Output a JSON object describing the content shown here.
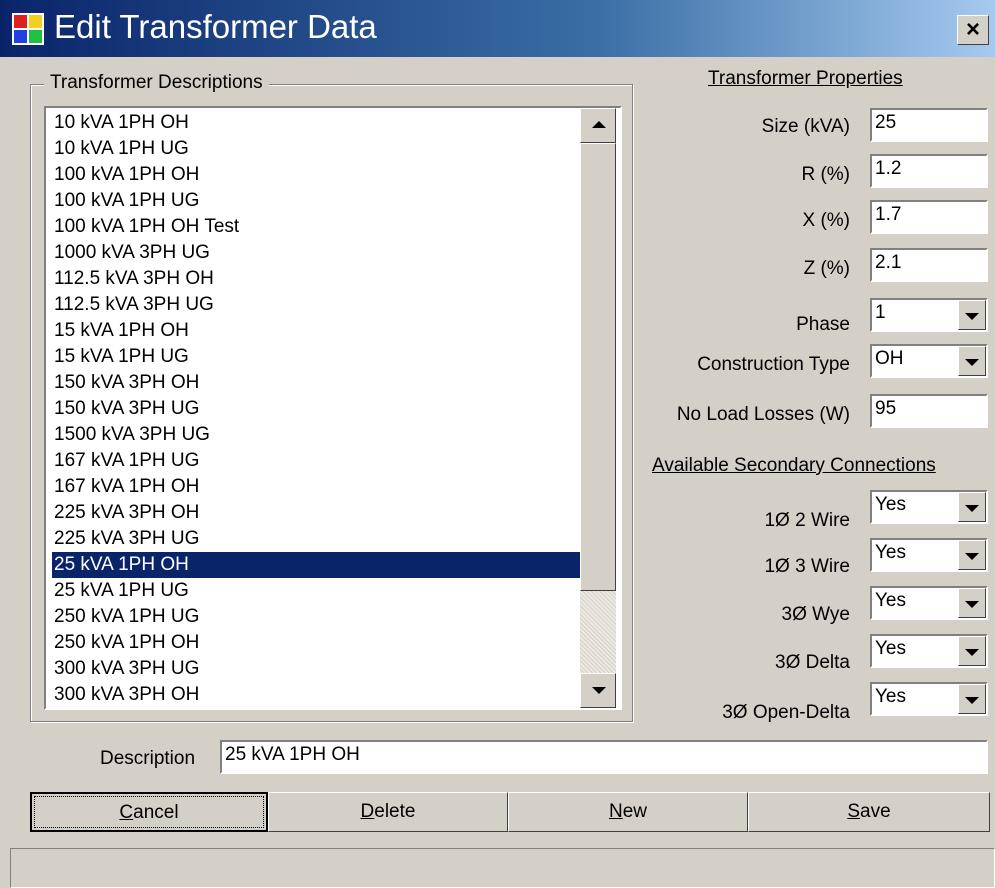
{
  "window": {
    "title": "Edit Transformer Data",
    "close_label": "×"
  },
  "descriptions": {
    "group_label": "Transformer Descriptions",
    "items": [
      "10 kVA 1PH OH",
      "10 kVA 1PH UG",
      "100 kVA 1PH OH",
      "100 kVA 1PH UG",
      "100 kVA 1PH OH Test",
      "1000 kVA 3PH UG",
      "112.5 kVA 3PH OH",
      "112.5 kVA 3PH UG",
      "15 kVA 1PH OH",
      "15 kVA 1PH UG",
      "150 kVA 3PH OH",
      "150 kVA 3PH UG",
      "1500 kVA 3PH UG",
      "167 kVA 1PH UG",
      "167 kVA 1PH OH",
      "225 kVA 3PH OH",
      "225 kVA 3PH UG",
      "25 kVA 1PH OH",
      "25 kVA 1PH UG",
      "250 kVA 1PH UG",
      "250 kVA 1PH OH",
      "300 kVA 3PH UG",
      "300 kVA 3PH OH"
    ],
    "selected": "25 kVA 1PH OH"
  },
  "properties": {
    "heading": "Transformer Properties",
    "size_label": "Size (kVA)",
    "size_value": "25",
    "r_label": "R (%)",
    "r_value": "1.2",
    "x_label": "X (%)",
    "x_value": "1.7",
    "z_label": "Z (%)",
    "z_value": "2.1",
    "phase_label": "Phase",
    "phase_value": "1",
    "construction_label": "Construction Type",
    "construction_value": "OH",
    "noload_label": "No Load Losses (W)",
    "noload_value": "95"
  },
  "connections": {
    "heading": "Available Secondary Connections",
    "items": [
      {
        "label": "1Ø 2 Wire",
        "value": "Yes"
      },
      {
        "label": "1Ø 3 Wire",
        "value": "Yes"
      },
      {
        "label": "3Ø Wye",
        "value": "Yes"
      },
      {
        "label": "3Ø Delta",
        "value": "Yes"
      },
      {
        "label": "3Ø Open-Delta",
        "value": "Yes"
      }
    ]
  },
  "description": {
    "label": "Description",
    "value": "25 kVA 1PH OH"
  },
  "buttons": {
    "cancel_label": "Cancel",
    "cancel_key": "C",
    "cancel_rest": "ancel",
    "delete_key": "D",
    "delete_rest": "elete",
    "new_key": "N",
    "new_rest": "ew",
    "save_key": "S",
    "save_rest": "ave"
  },
  "colors": {
    "face": "#d4d0c8",
    "title_start": "#0a246a",
    "title_end": "#a6caf0",
    "selection": "#0a246a"
  }
}
